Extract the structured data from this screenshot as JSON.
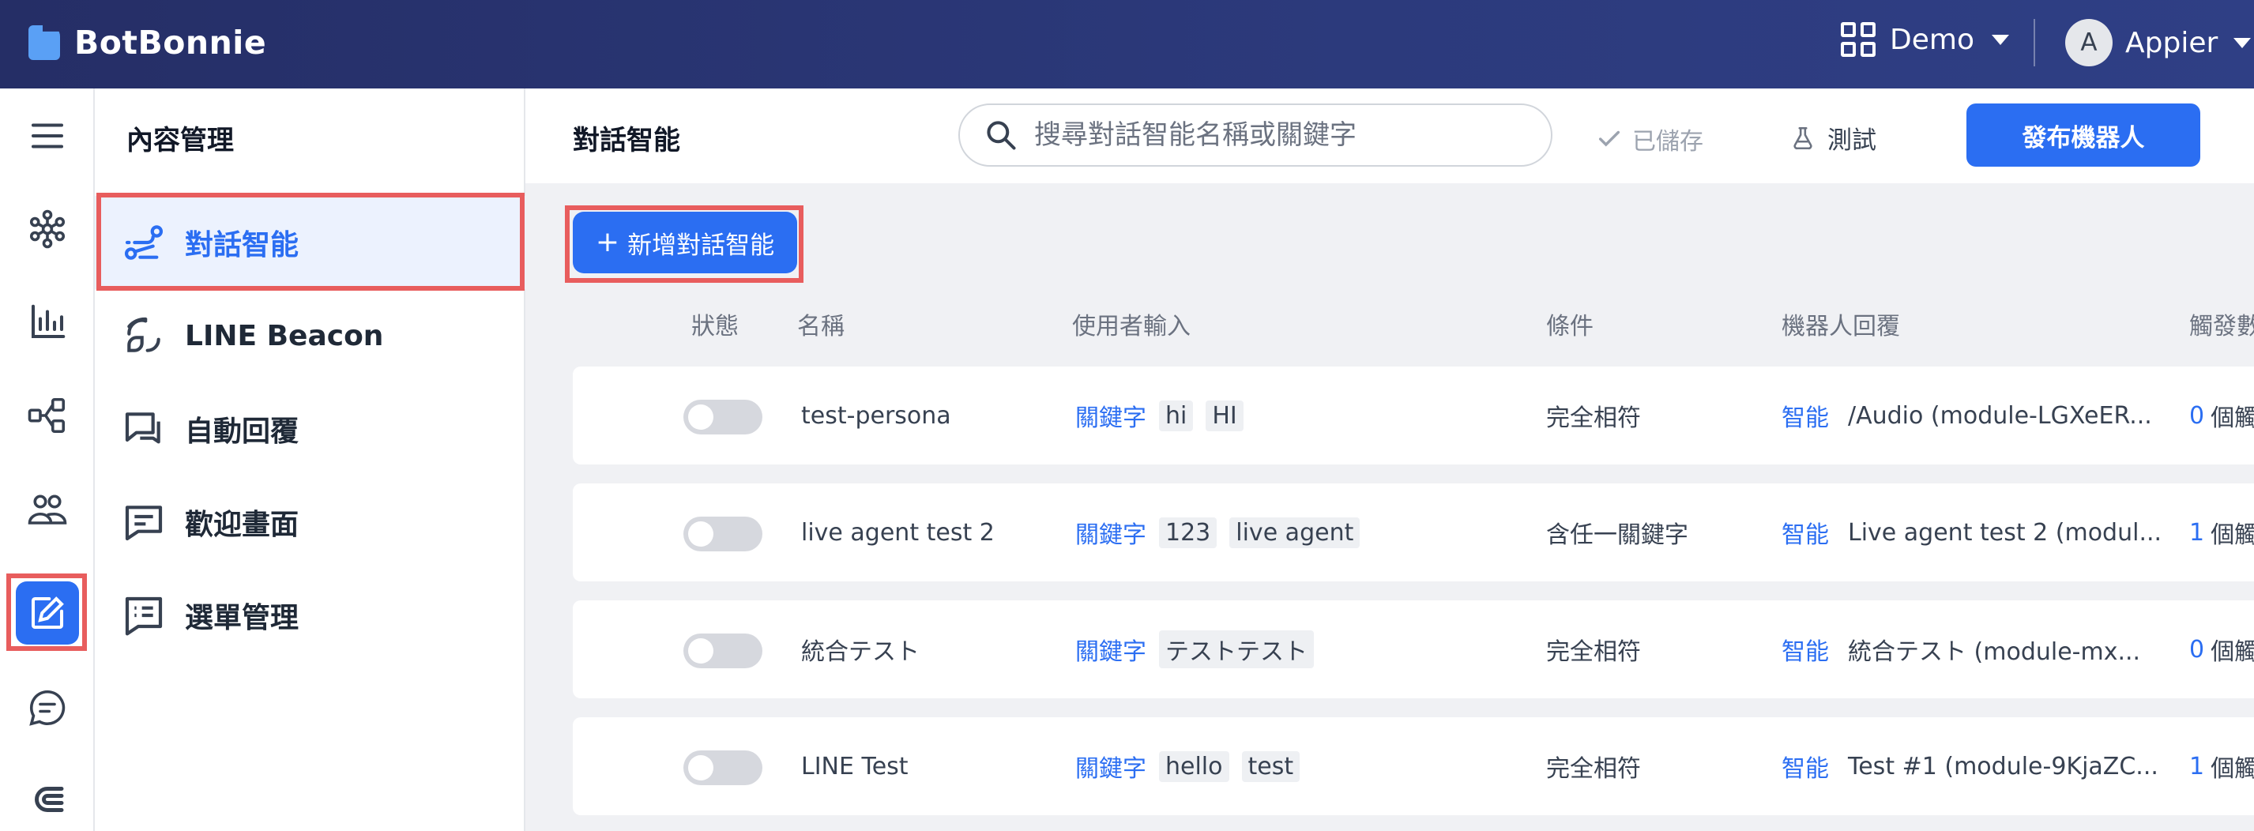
{
  "brand": {
    "name": "BotBonnie"
  },
  "topbar": {
    "workspace": "Demo",
    "user_initial": "A",
    "user_name": "Appier"
  },
  "rail": {
    "icons": [
      "menu-icon",
      "network-icon",
      "analytics-icon",
      "flow-icon",
      "users-icon",
      "content-icon",
      "chat-icon",
      "magnet-icon"
    ],
    "active": "content-icon"
  },
  "sidebar": {
    "title": "內容管理",
    "items": [
      {
        "label": "對話智能",
        "icon": "flow-route-icon",
        "active": true
      },
      {
        "label": "LINE Beacon",
        "icon": "beacon-icon",
        "active": false
      },
      {
        "label": "自動回覆",
        "icon": "auto-reply-icon",
        "active": false
      },
      {
        "label": "歡迎畫面",
        "icon": "welcome-icon",
        "active": false
      },
      {
        "label": "選單管理",
        "icon": "menu-manage-icon",
        "active": false
      }
    ]
  },
  "main": {
    "title": "對話智能",
    "search_placeholder": "搜尋對話智能名稱或關鍵字",
    "saved_label": "已儲存",
    "test_label": "測試",
    "publish_label": "發布機器人",
    "add_label": "新增對話智能",
    "columns": {
      "status": "狀態",
      "name": "名稱",
      "input": "使用者輸入",
      "condition": "條件",
      "reply": "機器人回覆",
      "trigger": "觸發數"
    },
    "rows": [
      {
        "name": "test-persona",
        "kw_label": "關鍵字",
        "tags": [
          "hi",
          "HI"
        ],
        "condition": "完全相符",
        "reply_type": "智能",
        "reply": "/Audio (module-LGXeER...",
        "count": "0",
        "count_unit": "個觸"
      },
      {
        "name": "live agent test 2",
        "kw_label": "關鍵字",
        "tags": [
          "123",
          "live agent"
        ],
        "condition": "含任一關鍵字",
        "reply_type": "智能",
        "reply": "Live agent test 2 (modul...",
        "count": "1",
        "count_unit": "個觸"
      },
      {
        "name": "統合テスト",
        "kw_label": "關鍵字",
        "tags": [
          "テストテスト"
        ],
        "condition": "完全相符",
        "reply_type": "智能",
        "reply": "統合テスト (module-mx...",
        "count": "0",
        "count_unit": "個觸"
      },
      {
        "name": "LINE Test",
        "kw_label": "關鍵字",
        "tags": [
          "hello",
          "test"
        ],
        "condition": "完全相符",
        "reply_type": "智能",
        "reply": "Test #1 (module-9KjaZC...",
        "count": "1",
        "count_unit": "個觸"
      }
    ]
  },
  "colors": {
    "brand_blue": "#2b6ef2",
    "topbar": "#2c3a7c",
    "highlight": "#e85d5d"
  }
}
